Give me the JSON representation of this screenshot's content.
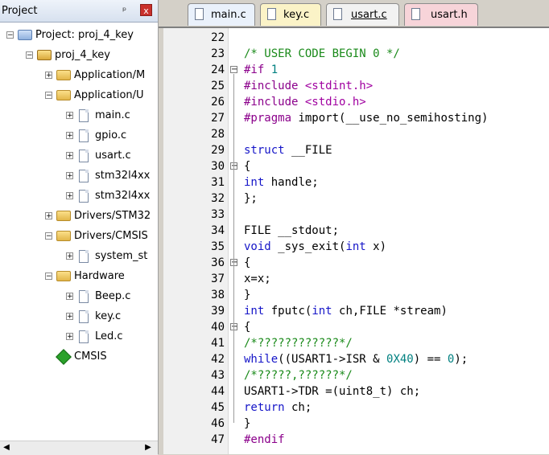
{
  "project_panel": {
    "title": "Project",
    "pin_glyph": "ᵖ",
    "close_glyph": "x",
    "tree": [
      {
        "label": "Project: proj_4_key",
        "icon": "project-icon",
        "depth": 0,
        "expander": "−"
      },
      {
        "label": "proj_4_key",
        "icon": "target-icon",
        "depth": 1,
        "expander": "−"
      },
      {
        "label": "Application/M",
        "icon": "folder-icon",
        "depth": 2,
        "expander": "+"
      },
      {
        "label": "Application/U",
        "icon": "folder-open-icon",
        "depth": 2,
        "expander": "−"
      },
      {
        "label": "main.c",
        "icon": "file-icon",
        "depth": 3,
        "expander": "+"
      },
      {
        "label": "gpio.c",
        "icon": "file-icon",
        "depth": 3,
        "expander": "+"
      },
      {
        "label": "usart.c",
        "icon": "file-icon",
        "depth": 3,
        "expander": "+"
      },
      {
        "label": "stm32l4xx",
        "icon": "file-icon",
        "depth": 3,
        "expander": "+"
      },
      {
        "label": "stm32l4xx",
        "icon": "file-icon",
        "depth": 3,
        "expander": "+"
      },
      {
        "label": "Drivers/STM32",
        "icon": "folder-icon",
        "depth": 2,
        "expander": "+"
      },
      {
        "label": "Drivers/CMSIS",
        "icon": "folder-open-icon",
        "depth": 2,
        "expander": "−"
      },
      {
        "label": "system_st",
        "icon": "file-icon",
        "depth": 3,
        "expander": "+"
      },
      {
        "label": "Hardware",
        "icon": "folder-open-icon",
        "depth": 2,
        "expander": "−"
      },
      {
        "label": "Beep.c",
        "icon": "file-icon",
        "depth": 3,
        "expander": "+"
      },
      {
        "label": "key.c",
        "icon": "file-icon",
        "depth": 3,
        "expander": "+"
      },
      {
        "label": "Led.c",
        "icon": "file-icon",
        "depth": 3,
        "expander": "+"
      },
      {
        "label": "CMSIS",
        "icon": "cmsis-icon",
        "depth": 2,
        "expander": ""
      }
    ]
  },
  "tabs": [
    {
      "label": "main.c",
      "active": false
    },
    {
      "label": "key.c",
      "active": false
    },
    {
      "label": "usart.c",
      "active": true
    },
    {
      "label": "usart.h",
      "active": false
    }
  ],
  "editor": {
    "lines": [
      {
        "n": "22",
        "fold": "",
        "segs": []
      },
      {
        "n": "23",
        "fold": "",
        "segs": [
          [
            "com",
            "/* USER CODE BEGIN 0 */"
          ]
        ]
      },
      {
        "n": "24",
        "fold": "−",
        "segs": [
          [
            "pp",
            "#if "
          ],
          [
            "num",
            "1"
          ]
        ]
      },
      {
        "n": "25",
        "fold": "",
        "segs": [
          [
            "pp",
            "#include "
          ],
          [
            "str",
            "<stdint.h>"
          ]
        ]
      },
      {
        "n": "26",
        "fold": "",
        "segs": [
          [
            "pp",
            "#include "
          ],
          [
            "str",
            "<stdio.h>"
          ]
        ]
      },
      {
        "n": "27",
        "fold": "",
        "segs": [
          [
            "pp",
            "#pragma"
          ],
          [
            "pl",
            " import(__use_no_semihosting)"
          ]
        ]
      },
      {
        "n": "28",
        "fold": "",
        "segs": []
      },
      {
        "n": "29",
        "fold": "",
        "segs": [
          [
            "kw",
            "struct"
          ],
          [
            "pl",
            " __FILE"
          ]
        ]
      },
      {
        "n": "30",
        "fold": "−",
        "segs": [
          [
            "pl",
            "{"
          ]
        ]
      },
      {
        "n": "31",
        "fold": "",
        "segs": [
          [
            "kw",
            "int"
          ],
          [
            "pl",
            " handle;"
          ]
        ]
      },
      {
        "n": "32",
        "fold": "",
        "segs": [
          [
            "pl",
            "};"
          ]
        ]
      },
      {
        "n": "33",
        "fold": "",
        "segs": []
      },
      {
        "n": "34",
        "fold": "",
        "segs": [
          [
            "pl",
            "FILE __stdout;"
          ]
        ]
      },
      {
        "n": "35",
        "fold": "",
        "segs": [
          [
            "kw",
            "void"
          ],
          [
            "pl",
            " _sys_exit("
          ],
          [
            "kw",
            "int"
          ],
          [
            "pl",
            " x)"
          ]
        ]
      },
      {
        "n": "36",
        "fold": "−",
        "segs": [
          [
            "pl",
            "{"
          ]
        ]
      },
      {
        "n": "37",
        "fold": "",
        "segs": [
          [
            "pl",
            "x=x;"
          ]
        ]
      },
      {
        "n": "38",
        "fold": "",
        "segs": [
          [
            "pl",
            "}"
          ]
        ]
      },
      {
        "n": "39",
        "fold": "",
        "segs": [
          [
            "kw",
            "int"
          ],
          [
            "pl",
            " fputc("
          ],
          [
            "kw",
            "int"
          ],
          [
            "pl",
            " ch,FILE *stream)"
          ]
        ]
      },
      {
        "n": "40",
        "fold": "−",
        "segs": [
          [
            "pl",
            "{"
          ]
        ]
      },
      {
        "n": "41",
        "fold": "",
        "segs": [
          [
            "com",
            "/*????????????*/"
          ]
        ]
      },
      {
        "n": "42",
        "fold": "",
        "segs": [
          [
            "kw",
            "while"
          ],
          [
            "pl",
            "((USART1->ISR & "
          ],
          [
            "num",
            "0X40"
          ],
          [
            "pl",
            ") == "
          ],
          [
            "num",
            "0"
          ],
          [
            "pl",
            ");"
          ]
        ]
      },
      {
        "n": "43",
        "fold": "",
        "segs": [
          [
            "com",
            "/*?????,??????*/"
          ]
        ]
      },
      {
        "n": "44",
        "fold": "",
        "segs": [
          [
            "pl",
            "USART1->TDR =(uint8_t) ch;"
          ]
        ]
      },
      {
        "n": "45",
        "fold": "",
        "segs": [
          [
            "kw",
            "return"
          ],
          [
            "pl",
            " ch;"
          ]
        ]
      },
      {
        "n": "46",
        "fold": "",
        "segs": [
          [
            "pl",
            "}"
          ]
        ]
      },
      {
        "n": "47",
        "fold": "",
        "segs": [
          [
            "pp",
            "#endif"
          ]
        ]
      }
    ]
  },
  "colors": {
    "comment": "#1a8a1a",
    "keyword": "#1515c8",
    "preprocessor": "#8b008b",
    "string": "#a000a0",
    "number": "#008080"
  }
}
